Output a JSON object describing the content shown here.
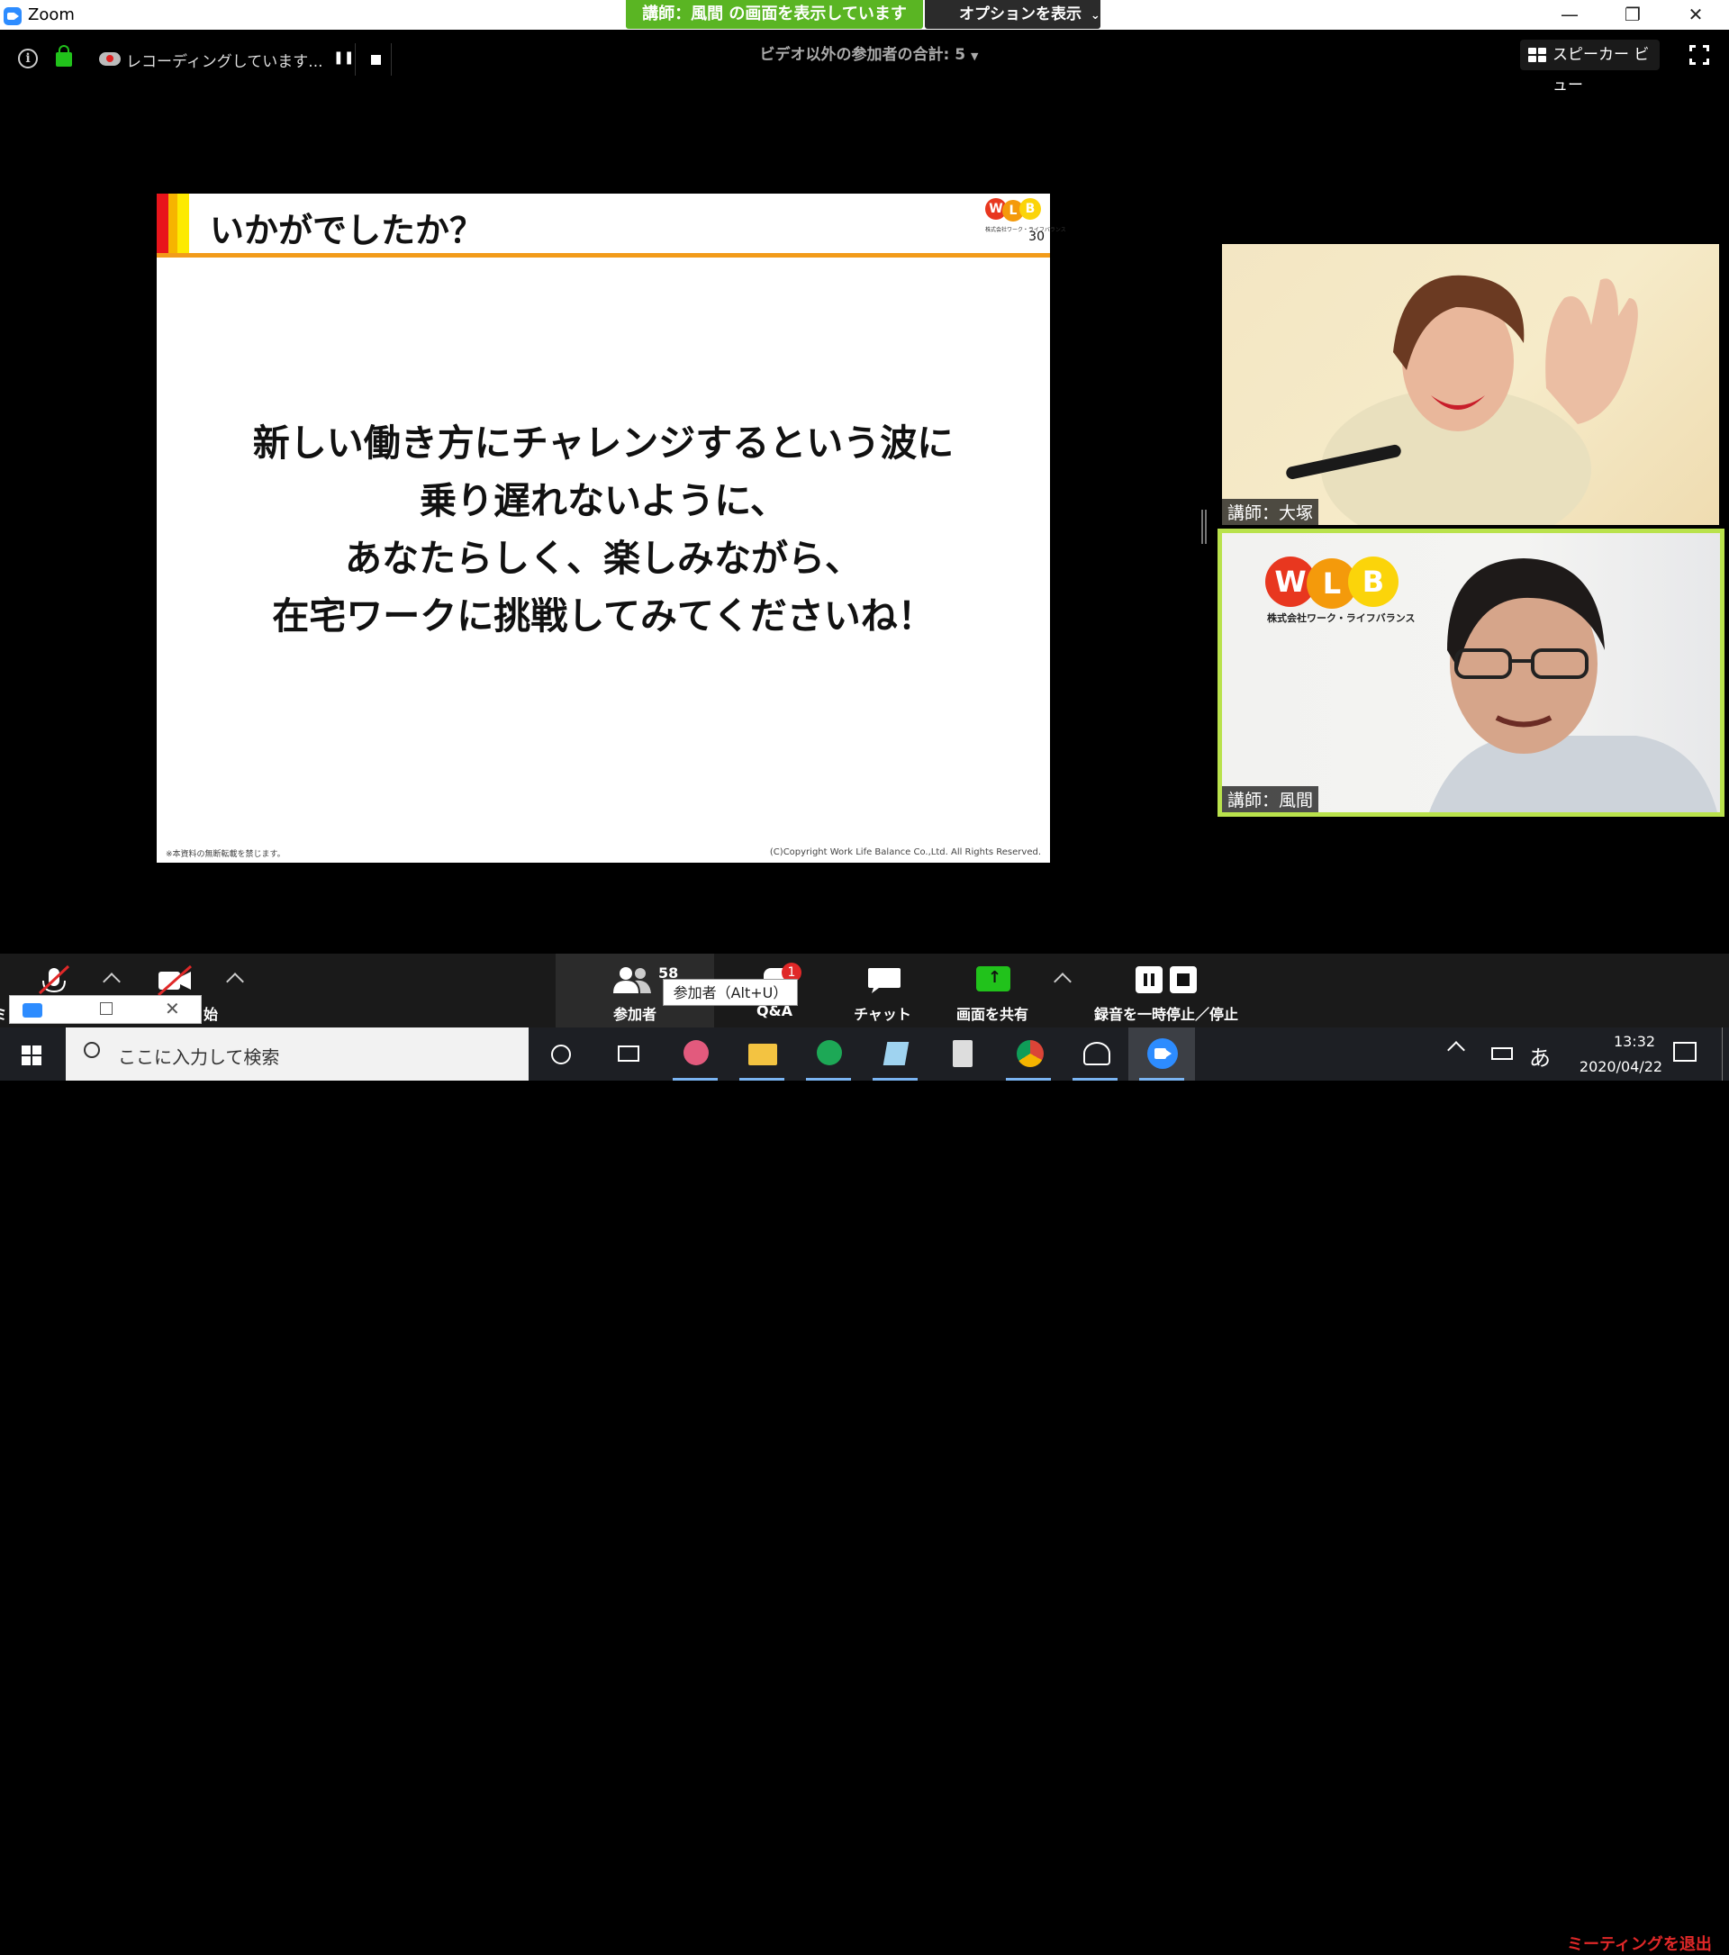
{
  "window": {
    "app_name": "Zoom",
    "share_banner": "講師：風間 の画面を表示しています",
    "options_label": "オプションを表示"
  },
  "meeting_bar": {
    "recording_text": "レコーディングしています...",
    "non_video_participants": "ビデオ以外の参加者の合計: 5",
    "speaker_view_label": "スピーカー ビュー"
  },
  "slide": {
    "title": "いかがでしたか？",
    "page_number": "30",
    "logo_text": "株式会社ワーク・ライフバランス",
    "body_lines": [
      "新しい働き方にチャレンジするという波に",
      "乗り遅れないように、",
      "あなたらしく、楽しみながら、",
      "在宅ワークに挑戦してみてくださいね！"
    ],
    "footer_left": "※本資料の無断転載を禁じます。",
    "footer_right": "(C)Copyright  Work Life Balance Co.,Ltd. All Rights Reserved.",
    "bar_colors": [
      "#e8141b",
      "#f6b400",
      "#fdea00"
    ]
  },
  "videos": [
    {
      "name": "講師：大塚"
    },
    {
      "name": "講師：風間",
      "logo_text": "株式会社ワーク・ライフバランス"
    }
  ],
  "toolbar": {
    "mute_label": "ミ",
    "video_label": "始",
    "participants_label": "参加者",
    "participants_count": "58",
    "participants_tooltip": "参加者（Alt+U）",
    "qa_label": "Q&A",
    "qa_badge": "1",
    "chat_label": "チャット",
    "share_label": "画面を共有",
    "record_label": "録音を一時停止／停止",
    "leave_label": "ミーティングを退出"
  },
  "taskbar": {
    "search_placeholder": "ここに入力して検索",
    "ime_label": "あ",
    "time": "13:32",
    "date": "2020/04/22"
  },
  "colors": {
    "share_green": "#5ab523",
    "active_speaker_border": "#b9e24c",
    "leave_red": "#e02828",
    "slide_underline": "#f29b1a"
  }
}
